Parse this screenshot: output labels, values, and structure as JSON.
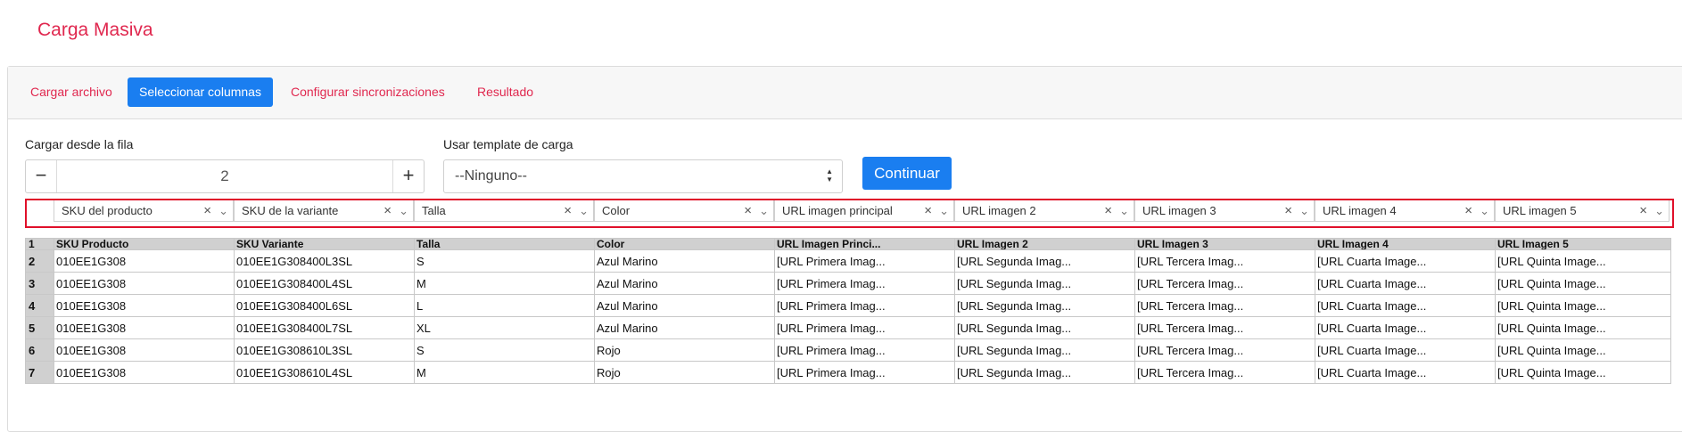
{
  "page": {
    "title": "Carga Masiva"
  },
  "tabs": [
    {
      "label": "Cargar archivo",
      "active": false
    },
    {
      "label": "Seleccionar columnas",
      "active": true
    },
    {
      "label": "Configurar sincronizaciones",
      "active": false
    },
    {
      "label": "Resultado",
      "active": false
    }
  ],
  "form": {
    "start_row_label": "Cargar desde la fila",
    "start_row_value": "2",
    "minus": "−",
    "plus": "+",
    "template_label": "Usar template de carga",
    "template_value": "--Ninguno--",
    "continue_label": "Continuar"
  },
  "column_mapping": [
    "SKU del producto",
    "SKU de la variante",
    "Talla",
    "Color",
    "URL imagen principal",
    "URL imagen 2",
    "URL imagen 3",
    "URL imagen 4",
    "URL imagen 5"
  ],
  "sheet": {
    "header_rownum": "1",
    "headers": [
      "SKU Producto",
      "SKU Variante",
      "Talla",
      "Color",
      "URL Imagen Princi...",
      "URL Imagen 2",
      "URL Imagen 3",
      "URL Imagen 4",
      "URL Imagen 5"
    ],
    "rows": [
      [
        "2",
        "010EE1G308",
        "010EE1G308400L3SL",
        "S",
        "Azul Marino",
        "[URL Primera Imag...",
        "[URL Segunda Imag...",
        "[URL Tercera Imag...",
        "[URL Cuarta Image...",
        "[URL Quinta Image..."
      ],
      [
        "3",
        "010EE1G308",
        "010EE1G308400L4SL",
        "M",
        "Azul Marino",
        "[URL Primera Imag...",
        "[URL Segunda Imag...",
        "[URL Tercera Imag...",
        "[URL Cuarta Image...",
        "[URL Quinta Image..."
      ],
      [
        "4",
        "010EE1G308",
        "010EE1G308400L6SL",
        "L",
        "Azul Marino",
        "[URL Primera Imag...",
        "[URL Segunda Imag...",
        "[URL Tercera Imag...",
        "[URL Cuarta Image...",
        "[URL Quinta Image..."
      ],
      [
        "5",
        "010EE1G308",
        "010EE1G308400L7SL",
        "XL",
        "Azul Marino",
        "[URL Primera Imag...",
        "[URL Segunda Imag...",
        "[URL Tercera Imag...",
        "[URL Cuarta Image...",
        "[URL Quinta Image..."
      ],
      [
        "6",
        "010EE1G308",
        "010EE1G308610L3SL",
        "S",
        "Rojo",
        "[URL Primera Imag...",
        "[URL Segunda Imag...",
        "[URL Tercera Imag...",
        "[URL Cuarta Image...",
        "[URL Quinta Image..."
      ],
      [
        "7",
        "010EE1G308",
        "010EE1G308610L4SL",
        "M",
        "Rojo",
        "[URL Primera Imag...",
        "[URL Segunda Imag...",
        "[URL Tercera Imag...",
        "[URL Cuarta Image...",
        "[URL Quinta Image..."
      ]
    ]
  },
  "icons": {
    "clear": "×",
    "chevron": "⌵",
    "select_arrows": "▲▼"
  },
  "colors": {
    "accent": "#e0284f",
    "primary": "#1a7ef0",
    "highlight": "#e0102a"
  }
}
